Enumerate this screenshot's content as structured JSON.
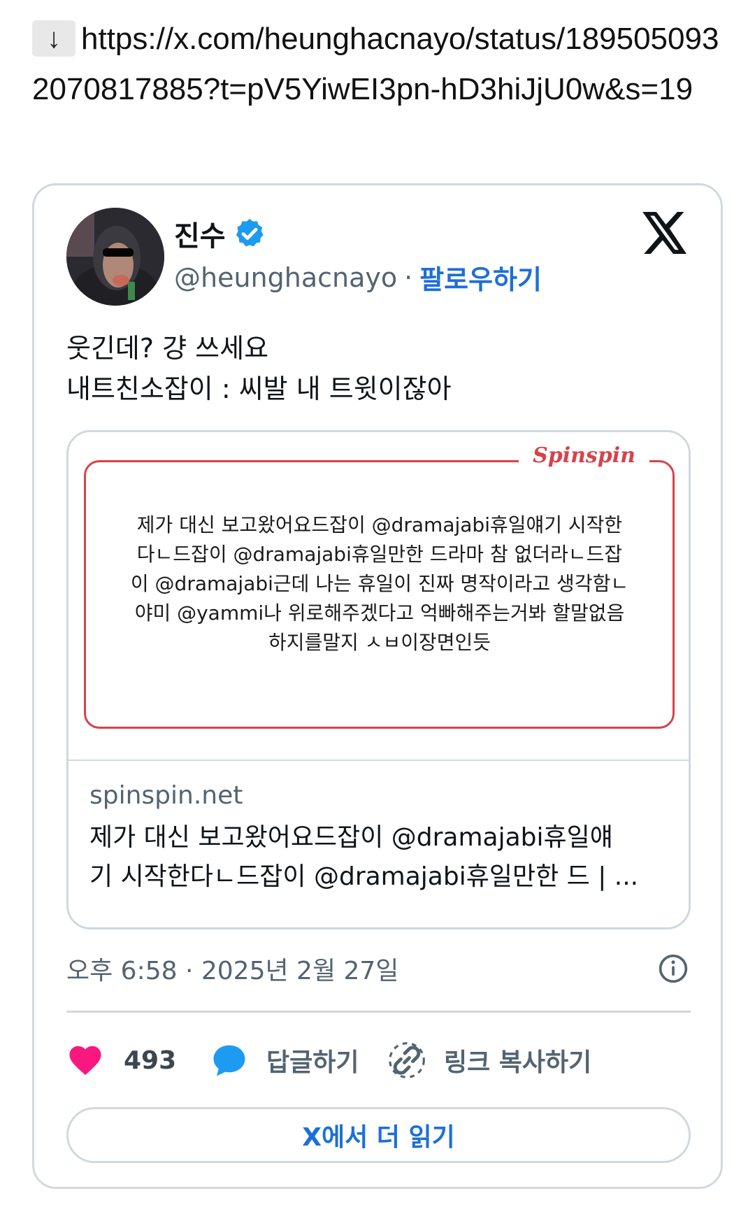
{
  "share": {
    "download_icon": "↓",
    "url": "https://x.com/heunghacnayo/status/1895050932070817885?t=pV5YiwEI3pn-hD3hiJjU0w&s=19"
  },
  "tweet": {
    "author_name": "진수",
    "handle": "@heunghacnayo",
    "separator": "·",
    "follow_label": "팔로우하기",
    "text_line1": "웃긴데? 걍 쓰세요",
    "text_line2": "내트친소잡이 : 씨발 내 트윗이잖아",
    "timestamp": "오후 6:58 · 2025년 2월 27일",
    "icons": {
      "verified": "verified-badge-icon",
      "platform": "x-logo-icon",
      "info": "info-icon"
    },
    "colors": {
      "accent": "#1d6fd6",
      "verified": "#1d9bf0",
      "like": "#f91880",
      "brand_red": "#d6434b"
    }
  },
  "embed": {
    "brand": "Spinspin",
    "image_lines": [
      "제가 대신 보고왔어요드잡이 @dramajabi휴일얘기 시작한",
      "다ㄴ드잡이 @dramajabi휴일만한 드라마 참 없더라ㄴ드잡",
      "이 @dramajabi근데 나는 휴일이 진짜 명작이라고 생각함ㄴ",
      "야미 @yammi나 위로해주겠다고 억빠해주는거봐 할말없음",
      "하지를말지 ㅅㅂ이장면인듯"
    ],
    "domain": "spinspin.net",
    "title_line1": "제가 대신 보고왔어요드잡이 @dramajabi휴일얘",
    "title_line2": "기 시작한다ㄴ드잡이 @dramajabi휴일만한 드 | ..."
  },
  "actions": {
    "like_count": "493",
    "reply_label": "답글하기",
    "copy_label": "링크 복사하기",
    "read_more_label": "X에서 더 읽기"
  }
}
